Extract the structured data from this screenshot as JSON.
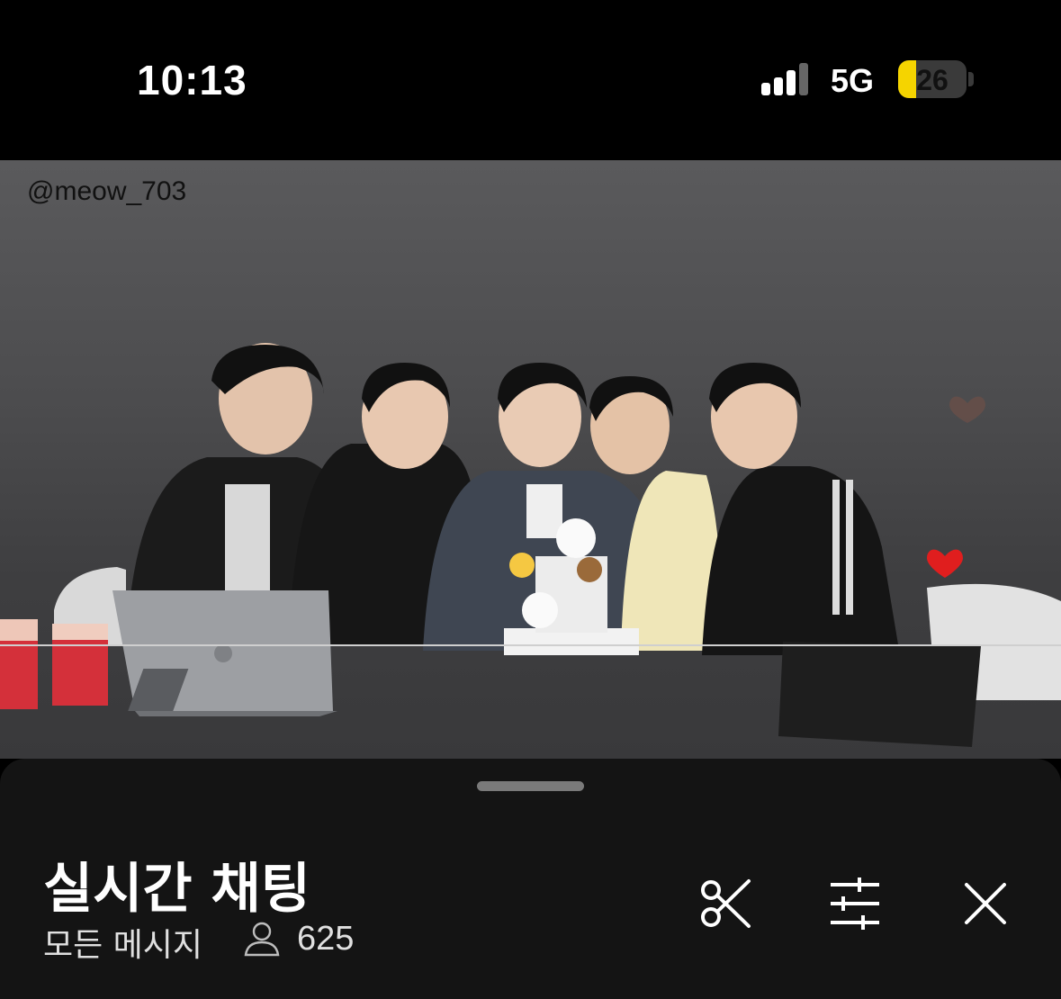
{
  "status_bar": {
    "time": "10:13",
    "network": "5G",
    "battery_level": "26",
    "battery_fraction": 0.26,
    "battery_color": "#f5d400"
  },
  "video": {
    "watermark": "@meow_703"
  },
  "panel": {
    "title": "실시간 채팅",
    "filter_label": "모든 메시지",
    "viewer_icon": "person-icon",
    "viewer_count": "625",
    "actions": [
      "scissors-icon",
      "sliders-icon",
      "close-icon"
    ]
  }
}
